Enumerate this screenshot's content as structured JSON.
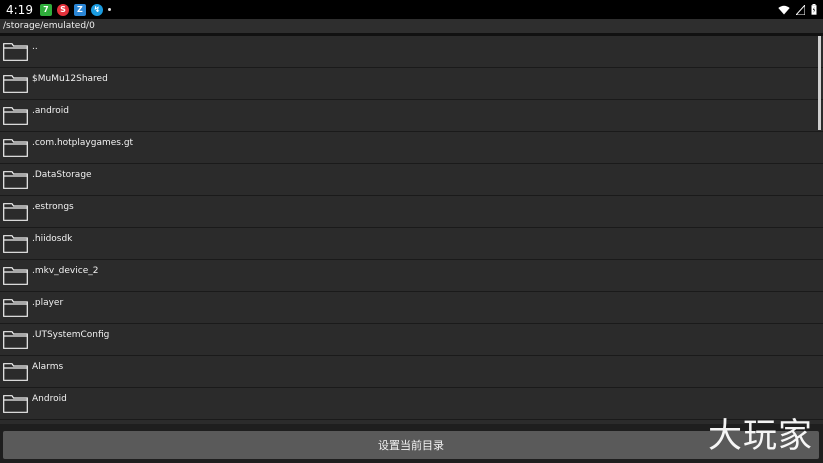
{
  "status_bar": {
    "time": "4:19",
    "notification_icons": [
      {
        "name": "app-7-icon",
        "glyph": "7",
        "color": "#2fae3b"
      },
      {
        "name": "app-red-icon",
        "glyph": "S",
        "color": "#e4313b"
      },
      {
        "name": "app-blue-icon",
        "glyph": "Z",
        "color": "#2b86d6"
      },
      {
        "name": "app-cyan-icon",
        "glyph": "↯",
        "color": "#1a9be0"
      }
    ],
    "right_icons": [
      "wifi-icon",
      "signal-icon",
      "battery-icon"
    ]
  },
  "path_bar": {
    "path": "/storage/emulated/0"
  },
  "file_list": {
    "items": [
      {
        "name": ".."
      },
      {
        "name": "$MuMu12Shared"
      },
      {
        "name": ".android"
      },
      {
        "name": ".com.hotplaygames.gt"
      },
      {
        "name": ".DataStorage"
      },
      {
        "name": ".estrongs"
      },
      {
        "name": ".hiidosdk"
      },
      {
        "name": ".mkv_device_2"
      },
      {
        "name": ".player"
      },
      {
        "name": ".UTSystemConfig"
      },
      {
        "name": "Alarms"
      },
      {
        "name": "Android"
      }
    ]
  },
  "footer": {
    "set_button_label": "设置当前目录"
  },
  "watermark": {
    "text": "大玩家"
  },
  "colors": {
    "background": "#1b1b1b",
    "row_background": "#2b2b2b",
    "button": "#5a5a5a",
    "text": "#f2f2f2"
  }
}
